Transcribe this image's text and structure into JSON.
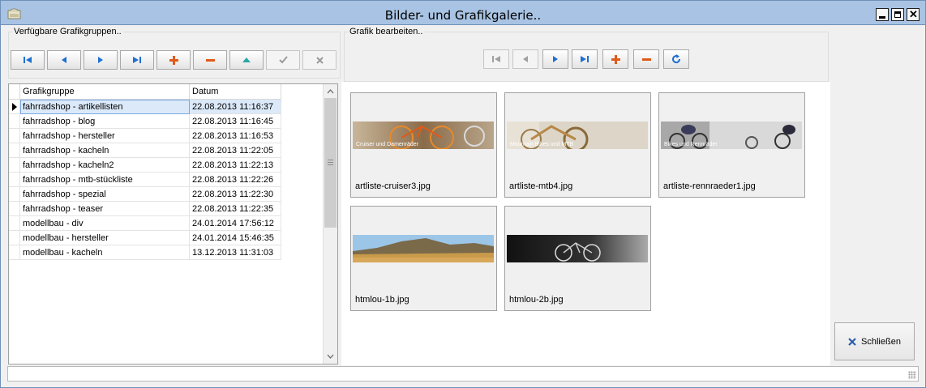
{
  "window": {
    "title": "Bilder- und Grafikgalerie..",
    "icon": "picture-gallery-icon"
  },
  "left_panel": {
    "group_label": "Verfügbare Grafikgruppen..",
    "toolbar": [
      {
        "name": "first-record-button",
        "icon": "first-icon",
        "enabled": true
      },
      {
        "name": "prev-record-button",
        "icon": "prev-icon",
        "enabled": true
      },
      {
        "name": "next-record-button",
        "icon": "next-icon",
        "enabled": true
      },
      {
        "name": "last-record-button",
        "icon": "last-icon",
        "enabled": true
      },
      {
        "name": "add-record-button",
        "icon": "plus-icon",
        "enabled": true
      },
      {
        "name": "delete-record-button",
        "icon": "minus-icon",
        "enabled": true
      },
      {
        "name": "edit-record-button",
        "icon": "up-triangle-icon",
        "enabled": true
      },
      {
        "name": "post-record-button",
        "icon": "check-icon",
        "enabled": false
      },
      {
        "name": "cancel-record-button",
        "icon": "x-icon",
        "enabled": false
      }
    ],
    "grid": {
      "columns": [
        "Grafikgruppe",
        "Datum"
      ],
      "rows": [
        {
          "group": "fahrradshop - artikellisten",
          "date": "22.08.2013 11:16:37",
          "selected": true
        },
        {
          "group": "fahrradshop - blog",
          "date": "22.08.2013 11:16:45"
        },
        {
          "group": "fahrradshop - hersteller",
          "date": "22.08.2013 11:16:53"
        },
        {
          "group": "fahrradshop - kacheln",
          "date": "22.08.2013 11:22:05"
        },
        {
          "group": "fahrradshop - kacheln2",
          "date": "22.08.2013 11:22:13"
        },
        {
          "group": "fahrradshop - mtb-stückliste",
          "date": "22.08.2013 11:22:26"
        },
        {
          "group": "fahrradshop - spezial",
          "date": "22.08.2013 11:22:30"
        },
        {
          "group": "fahrradshop - teaser",
          "date": "22.08.2013 11:22:35"
        },
        {
          "group": "modellbau - div",
          "date": "24.01.2014 17:56:12"
        },
        {
          "group": "modellbau - hersteller",
          "date": "24.01.2014 15:46:35"
        },
        {
          "group": "modellbau - kacheln",
          "date": "13.12.2013 11:31:03"
        }
      ]
    }
  },
  "right_panel": {
    "group_label": "Grafik bearbeiten..",
    "toolbar": [
      {
        "name": "first-image-button",
        "icon": "first-icon",
        "enabled": false
      },
      {
        "name": "prev-image-button",
        "icon": "prev-icon",
        "enabled": false
      },
      {
        "name": "next-image-button",
        "icon": "next-icon",
        "enabled": true
      },
      {
        "name": "last-image-button",
        "icon": "last-icon",
        "enabled": true
      },
      {
        "name": "add-image-button",
        "icon": "plus-icon",
        "enabled": true
      },
      {
        "name": "delete-image-button",
        "icon": "minus-icon",
        "enabled": true
      },
      {
        "name": "refresh-image-button",
        "icon": "refresh-icon",
        "enabled": true
      }
    ],
    "images": [
      {
        "filename": "artliste-cruiser3.jpg",
        "overlay": "Cruiser und Damenräder"
      },
      {
        "filename": "artliste-mtb4.jpg",
        "overlay": "Mountain Bikes und MTB"
      },
      {
        "filename": "artliste-rennraeder1.jpg",
        "overlay": "Bikes und Rennräder"
      },
      {
        "filename": "htmlou-1b.jpg",
        "overlay": ""
      },
      {
        "filename": "htmlou-2b.jpg",
        "overlay": ""
      }
    ]
  },
  "close_button": {
    "label": "Schließen",
    "icon": "close-x-icon"
  },
  "colors": {
    "titlebar": "#a8c3e3",
    "accent_blue": "#1e6fd0",
    "accent_orange": "#e05a1a",
    "accent_teal": "#2aa6a6",
    "selection": "#dbe9f9"
  }
}
